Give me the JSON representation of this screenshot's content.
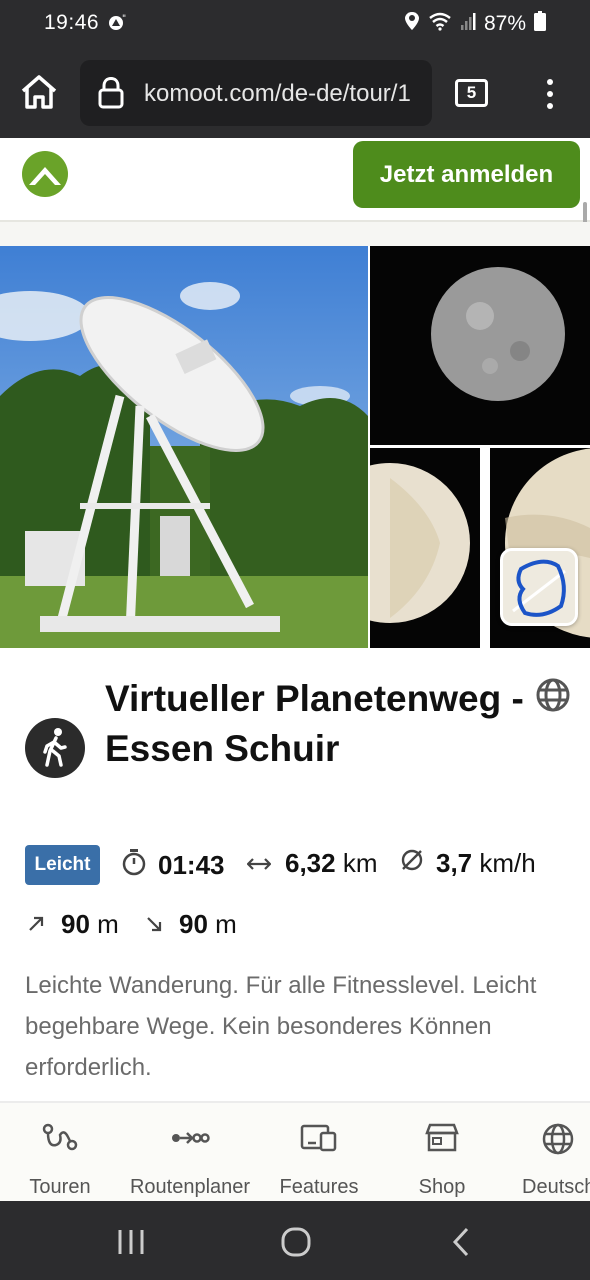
{
  "status_bar": {
    "time": "19:46",
    "battery": "87%",
    "icons": [
      "location-icon",
      "wifi-icon",
      "signal-icon",
      "battery-icon",
      "notification-icon"
    ]
  },
  "browser": {
    "url": "komoot.com/de-de/tour/1",
    "tab_count": "5"
  },
  "header": {
    "signin_label": "Jetzt anmelden",
    "brand_color": "#4e8c1c"
  },
  "tour": {
    "title": "Virtueller Planetenweg - Essen Schuir",
    "difficulty": "Leicht",
    "duration": "01:43",
    "distance_value": "6,32",
    "distance_unit": "km",
    "speed_value": "3,7",
    "speed_unit": "km/h",
    "ascent_value": "90",
    "ascent_unit": "m",
    "descent_value": "90",
    "descent_unit": "m",
    "description": "Leichte Wanderung. Für alle Fitnesslevel. Leicht begehbare Wege. Kein besonderes Können erforderlich."
  },
  "bottom_nav": {
    "items": [
      {
        "label": "Touren",
        "icon": "tours-icon"
      },
      {
        "label": "Routenplaner",
        "icon": "route-planner-icon"
      },
      {
        "label": "Features",
        "icon": "features-icon"
      },
      {
        "label": "Shop",
        "icon": "shop-icon"
      },
      {
        "label": "Deutsch",
        "icon": "globe-icon"
      }
    ]
  }
}
